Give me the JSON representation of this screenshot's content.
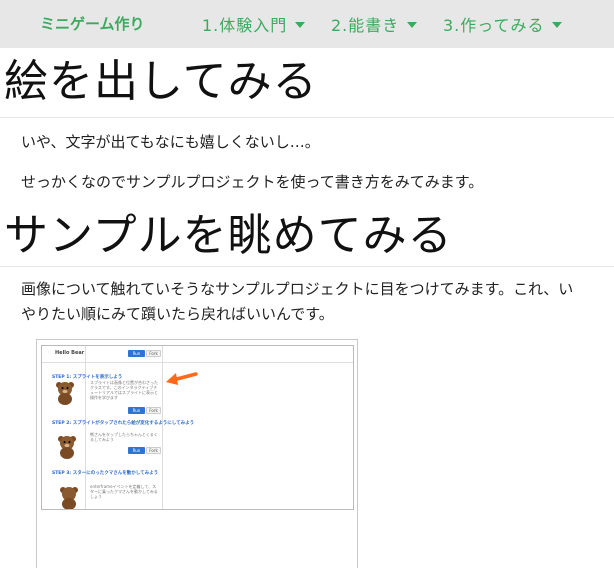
{
  "nav": {
    "brand": "ミニゲーム作り",
    "items": [
      {
        "label": "1.体験入門"
      },
      {
        "label": "2.能書き"
      },
      {
        "label": "3.作ってみる"
      }
    ]
  },
  "section1": {
    "title": "絵を出してみる",
    "paragraphs": [
      "いや、文字が出てもなにも嬉しくないし…。",
      "せっかくなのでサンプルプロジェクトを使って書き方をみてみます。"
    ]
  },
  "section2": {
    "title": "サンプルを眺めてみる",
    "paragraph_line1": "画像について触れていそうなサンプルプロジェクトに目をつけてみます。これ、い",
    "paragraph_line2": "やりたい順にみて躓いたら戻ればいいんです。"
  },
  "screenshot": {
    "header_text": "Hello Bear",
    "run_label": "Run",
    "fork_label": "Fork",
    "steps": [
      {
        "title": "STEP 1: スプライトを表示しよう",
        "desc": "スプライトは画像と位置が合わさったクラスです。このインタラクティブチュートリアルではスプライトに表示と操作を学びます"
      },
      {
        "title": "STEP 2: スプライトがタップされたら絵が変化するようにしてみよう",
        "desc": "熊さんをタップしたらちゃんとくるくるしてみよう"
      },
      {
        "title": "STEP 3: スターにのったクマさんを動かしてみよう",
        "desc": "enterframeイベントを定義して、スターに乗ったクマさんを動かしてみましょう"
      }
    ],
    "colors": {
      "accent": "#ff6a1a",
      "link": "#2a6ad0",
      "button": "#2f73d6"
    }
  }
}
